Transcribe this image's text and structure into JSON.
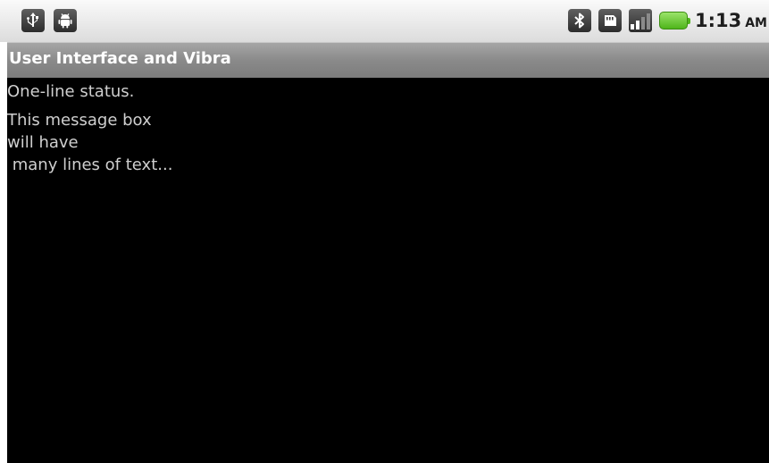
{
  "status_bar": {
    "left_icons": [
      "usb-icon",
      "android-debug-icon"
    ],
    "right_icons": [
      "bluetooth-icon",
      "sd-card-icon",
      "signal-icon",
      "battery-icon"
    ],
    "time": "1:13",
    "ampm": "AM",
    "battery_color": "#4fb51b"
  },
  "title_bar": {
    "title": "User Interface and Vibra"
  },
  "content": {
    "status_text": "One-line status.",
    "message_text": "This message box\nwill have\n many lines of text..."
  }
}
